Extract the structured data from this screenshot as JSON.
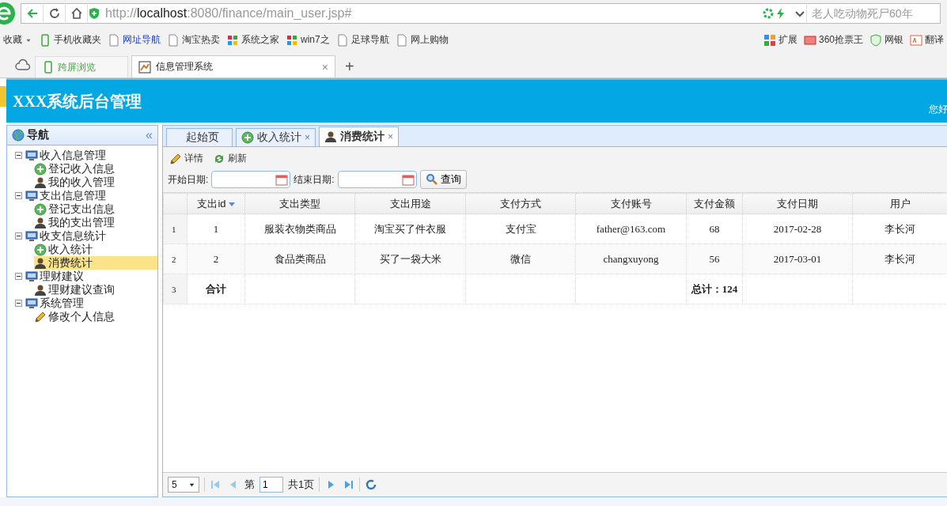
{
  "browser": {
    "url": "http://**localhost**:8080/finance/main_user.jsp#",
    "search_placeholder": "老人吃动物死尸60年",
    "bookmarks": [
      {
        "label": "收藏",
        "kind": "menu"
      },
      {
        "label": "手机收藏夹",
        "kind": "phone"
      },
      {
        "label": "网址导航",
        "kind": "link"
      },
      {
        "label": "淘宝热卖",
        "kind": "page"
      },
      {
        "label": "系统之家",
        "kind": "win"
      },
      {
        "label": "win7之",
        "kind": "win"
      },
      {
        "label": "足球导航",
        "kind": "page"
      },
      {
        "label": "网上购物",
        "kind": "page"
      }
    ],
    "extensions": [
      {
        "label": "扩展",
        "kind": "grid"
      },
      {
        "label": "360抢票王",
        "kind": "ticket"
      },
      {
        "label": "网银",
        "kind": "shield"
      },
      {
        "label": "翻译",
        "kind": "translate"
      }
    ],
    "cross_screen": "跨屏浏览",
    "tabs": [
      {
        "label": "信息管理系统",
        "close": "×",
        "selected": true
      }
    ],
    "new_tab": "+"
  },
  "app": {
    "title": "XXX系统后台管理",
    "greeting": "您好",
    "nav": {
      "title": "导航",
      "collapse": "«",
      "tree": [
        {
          "label": "收入信息管理",
          "kind": "group",
          "expanded": true,
          "selected": false,
          "children": [
            {
              "label": "登记收入信息",
              "kind": "register",
              "selected": false
            },
            {
              "label": "我的收入管理",
              "kind": "list",
              "selected": false
            }
          ]
        },
        {
          "label": "支出信息管理",
          "kind": "group",
          "expanded": true,
          "selected": false,
          "children": [
            {
              "label": "登记支出信息",
              "kind": "register",
              "selected": false
            },
            {
              "label": "我的支出管理",
              "kind": "list",
              "selected": false
            }
          ]
        },
        {
          "label": "收支信息统计",
          "kind": "group",
          "expanded": true,
          "selected": false,
          "children": [
            {
              "label": "收入统计",
              "kind": "register",
              "selected": false
            },
            {
              "label": "消费统计",
              "kind": "list",
              "selected": true
            }
          ]
        },
        {
          "label": "理财建议",
          "kind": "group",
          "expanded": true,
          "selected": false,
          "children": [
            {
              "label": "理财建议查询",
              "kind": "list",
              "selected": false
            }
          ]
        },
        {
          "label": "系统管理",
          "kind": "group",
          "expanded": true,
          "selected": false,
          "children": [
            {
              "label": "修改个人信息",
              "kind": "edit",
              "selected": false
            }
          ]
        }
      ]
    },
    "tabs": [
      {
        "label": "起始页",
        "kind": "home",
        "selected": false
      },
      {
        "label": "收入统计",
        "kind": "register",
        "close": "×",
        "selected": false
      },
      {
        "label": "消费统计",
        "kind": "list",
        "close": "×",
        "selected": true
      }
    ],
    "toolbar": [
      {
        "label": "详情",
        "kind": "details"
      },
      {
        "label": "刷新",
        "kind": "refresh"
      }
    ],
    "filters": [
      {
        "label": "开始日期:"
      },
      {
        "label": "结束日期:"
      }
    ],
    "search_button": "查询",
    "table": {
      "columns": [
        {
          "label": "支出id",
          "sorted": true
        },
        {
          "label": "支出类型",
          "sorted": false
        },
        {
          "label": "支出用途",
          "sorted": false
        },
        {
          "label": "支付方式",
          "sorted": false
        },
        {
          "label": "支付账号",
          "sorted": false
        },
        {
          "label": "支付金额",
          "sorted": false
        },
        {
          "label": "支付日期",
          "sorted": false
        },
        {
          "label": "用户",
          "sorted": false
        }
      ],
      "rows": [
        {
          "num": "1",
          "kind": "data",
          "cells": [
            "1",
            "服装衣物类商品",
            "淘宝买了件衣服",
            "支付宝",
            "father@163.com",
            "68",
            "2017-02-28",
            "李长河"
          ]
        },
        {
          "num": "2",
          "kind": "data",
          "cells": [
            "2",
            "食品类商品",
            "买了一袋大米",
            "微信",
            "changxuyong",
            "56",
            "2017-03-01",
            "李长河"
          ]
        },
        {
          "num": "3",
          "kind": "total",
          "label": "合计",
          "sum": "总计：124"
        }
      ]
    },
    "pager": {
      "page_size": "5",
      "page_label": "第",
      "page": "1",
      "total": "共1页"
    }
  }
}
